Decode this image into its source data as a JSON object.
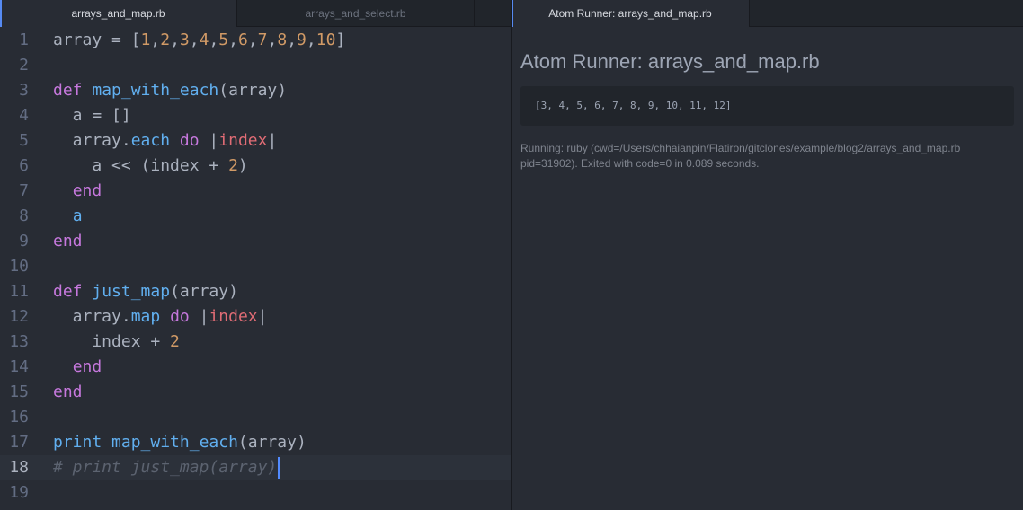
{
  "left_tabs": [
    {
      "label": "arrays_and_map.rb",
      "active": true
    },
    {
      "label": "arrays_and_select.rb",
      "active": false
    }
  ],
  "right_tab": {
    "label": "Atom Runner: arrays_and_map.rb"
  },
  "editor": {
    "lines": [
      {
        "n": "1",
        "tokens": [
          [
            "plain",
            "array = ["
          ],
          [
            "num",
            "1"
          ],
          [
            "plain",
            ","
          ],
          [
            "num",
            "2"
          ],
          [
            "plain",
            ","
          ],
          [
            "num",
            "3"
          ],
          [
            "plain",
            ","
          ],
          [
            "num",
            "4"
          ],
          [
            "plain",
            ","
          ],
          [
            "num",
            "5"
          ],
          [
            "plain",
            ","
          ],
          [
            "num",
            "6"
          ],
          [
            "plain",
            ","
          ],
          [
            "num",
            "7"
          ],
          [
            "plain",
            ","
          ],
          [
            "num",
            "8"
          ],
          [
            "plain",
            ","
          ],
          [
            "num",
            "9"
          ],
          [
            "plain",
            ","
          ],
          [
            "num",
            "10"
          ],
          [
            "plain",
            "]"
          ]
        ]
      },
      {
        "n": "2",
        "tokens": []
      },
      {
        "n": "3",
        "tokens": [
          [
            "kw",
            "def"
          ],
          [
            "plain",
            " "
          ],
          [
            "fn",
            "map_with_each"
          ],
          [
            "plain",
            "(array)"
          ]
        ]
      },
      {
        "n": "4",
        "tokens": [
          [
            "plain",
            "  a = []"
          ]
        ]
      },
      {
        "n": "5",
        "tokens": [
          [
            "plain",
            "  array."
          ],
          [
            "fn",
            "each"
          ],
          [
            "plain",
            " "
          ],
          [
            "kw",
            "do"
          ],
          [
            "plain",
            " |"
          ],
          [
            "var",
            "index"
          ],
          [
            "plain",
            "|"
          ]
        ]
      },
      {
        "n": "6",
        "tokens": [
          [
            "plain",
            "    a << (index + "
          ],
          [
            "num",
            "2"
          ],
          [
            "plain",
            ")"
          ]
        ]
      },
      {
        "n": "7",
        "tokens": [
          [
            "plain",
            "  "
          ],
          [
            "kw",
            "end"
          ]
        ]
      },
      {
        "n": "8",
        "tokens": [
          [
            "plain",
            "  "
          ],
          [
            "fn",
            "a"
          ]
        ]
      },
      {
        "n": "9",
        "tokens": [
          [
            "kw",
            "end"
          ]
        ]
      },
      {
        "n": "10",
        "tokens": []
      },
      {
        "n": "11",
        "tokens": [
          [
            "kw",
            "def"
          ],
          [
            "plain",
            " "
          ],
          [
            "fn",
            "just_map"
          ],
          [
            "plain",
            "(array)"
          ]
        ]
      },
      {
        "n": "12",
        "tokens": [
          [
            "plain",
            "  array."
          ],
          [
            "fn",
            "map"
          ],
          [
            "plain",
            " "
          ],
          [
            "kw",
            "do"
          ],
          [
            "plain",
            " |"
          ],
          [
            "var",
            "index"
          ],
          [
            "plain",
            "|"
          ]
        ]
      },
      {
        "n": "13",
        "tokens": [
          [
            "plain",
            "    index + "
          ],
          [
            "num",
            "2"
          ]
        ]
      },
      {
        "n": "14",
        "tokens": [
          [
            "plain",
            "  "
          ],
          [
            "kw",
            "end"
          ]
        ]
      },
      {
        "n": "15",
        "tokens": [
          [
            "kw",
            "end"
          ]
        ]
      },
      {
        "n": "16",
        "tokens": []
      },
      {
        "n": "17",
        "tokens": [
          [
            "fn",
            "print"
          ],
          [
            "plain",
            " "
          ],
          [
            "fn",
            "map_with_each"
          ],
          [
            "plain",
            "(array)"
          ]
        ]
      },
      {
        "n": "18",
        "tokens": [
          [
            "cmt",
            "# print just_map(array)"
          ]
        ],
        "cursor": true
      },
      {
        "n": "19",
        "tokens": []
      }
    ]
  },
  "runner": {
    "title": "Atom Runner: arrays_and_map.rb",
    "output": "[3, 4, 5, 6, 7, 8, 9, 10, 11, 12]",
    "status_line1": "Running: ruby (cwd=/Users/chhaianpin/Flatiron/gitclones/example/blog2/arrays_and_map.rb",
    "status_line2": "pid=31902). Exited with code=0 in 0.089 seconds."
  },
  "colors": {
    "background": "#282c34",
    "keyword": "#c678dd",
    "function": "#61afef",
    "number": "#d19a66",
    "variable": "#e06c75",
    "comment": "#5c6370",
    "accent": "#568af2"
  }
}
